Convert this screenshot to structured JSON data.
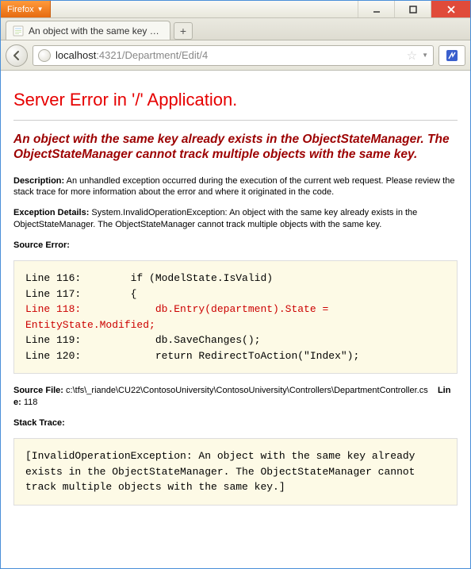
{
  "caption": {
    "firefox_label": "Firefox"
  },
  "tab": {
    "title": "An object with the same key already exis..."
  },
  "nav": {
    "url_prefix": "localhost",
    "url_rest": ":4321/Department/Edit/4"
  },
  "page": {
    "title": "Server Error in '/' Application.",
    "subtitle": "An object with the same key already exists in the ObjectStateManager. The ObjectStateManager cannot track multiple objects with the same key.",
    "description_label": "Description:",
    "description_text": " An unhandled exception occurred during the execution of the current web request. Please review the stack trace for more information about the error and where it originated in the code.",
    "exception_label": "Exception Details:",
    "exception_text": " System.InvalidOperationException: An object with the same key already exists in the ObjectStateManager. The ObjectStateManager cannot track multiple objects with the same key.",
    "source_error_label": "Source Error:",
    "code_lines": [
      {
        "n": "Line 116:",
        "c": "        if (ModelState.IsValid)",
        "err": false
      },
      {
        "n": "Line 117:",
        "c": "        {",
        "err": false
      },
      {
        "n": "Line 118:",
        "c": "            db.Entry(department).State = EntityState.Modified;",
        "err": true
      },
      {
        "n": "Line 119:",
        "c": "            db.SaveChanges();",
        "err": false
      },
      {
        "n": "Line 120:",
        "c": "            return RedirectToAction(\"Index\");",
        "err": false
      }
    ],
    "source_file_label": "Source File:",
    "source_file_path": " c:\\tfs\\_riande\\CU22\\ContosoUniversity\\ContosoUniversity\\Controllers\\DepartmentController.cs",
    "line_label": "Line:",
    "line_number": " 118",
    "stack_trace_label": "Stack Trace:",
    "stack_trace_text": "[InvalidOperationException: An object with the same key already exists in the ObjectStateManager. The ObjectStateManager cannot track multiple objects with the same key.]"
  }
}
